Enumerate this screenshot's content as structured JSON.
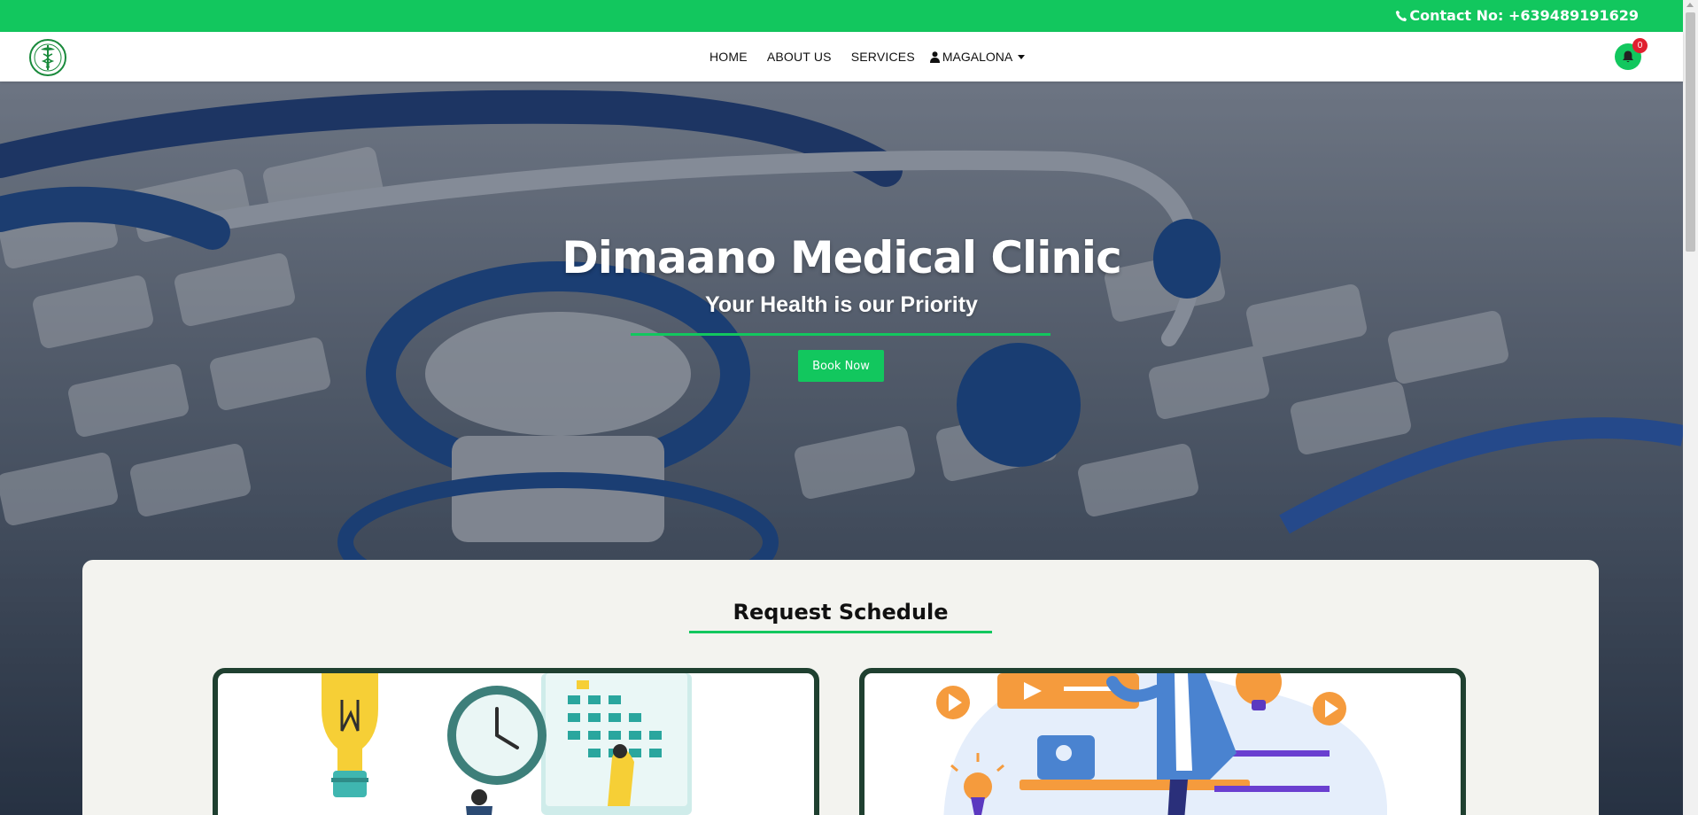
{
  "topbar": {
    "contact_label": "Contact No: +639489191629",
    "phone_icon": "phone-icon"
  },
  "nav": {
    "items": [
      {
        "label": "HOME"
      },
      {
        "label": "ABOUT US"
      },
      {
        "label": "SERVICES"
      }
    ],
    "user_label": "MAGALONA",
    "notification_count": "0"
  },
  "hero": {
    "title": "Dimaano Medical Clinic",
    "subtitle": "Your Health is our Priority",
    "book_button": "Book Now"
  },
  "section": {
    "title": "Request Schedule"
  },
  "colors": {
    "brand_green": "#12c75e",
    "card_border": "#1f4030",
    "badge_red": "#e0202f"
  }
}
